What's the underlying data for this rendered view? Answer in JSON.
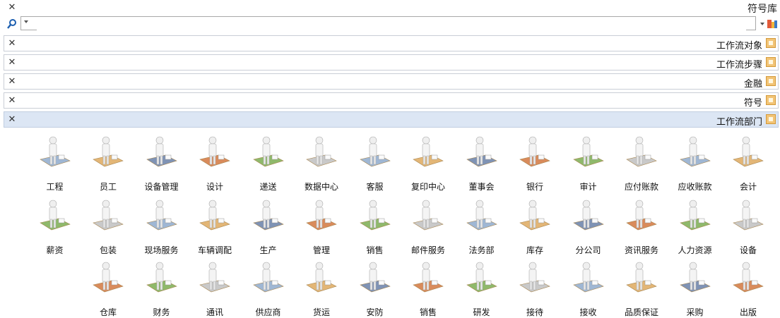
{
  "panel": {
    "title": "符号库"
  },
  "search": {
    "value": "",
    "placeholder": ""
  },
  "categories": [
    {
      "label": "工作流对象",
      "active": false
    },
    {
      "label": "工作流步骤",
      "active": false
    },
    {
      "label": "金融",
      "active": false
    },
    {
      "label": "符号",
      "active": false
    },
    {
      "label": "工作流部门",
      "active": true
    }
  ],
  "shapes": {
    "row1": [
      {
        "label": "会计",
        "icon": "accountant-icon"
      },
      {
        "label": "应收账款",
        "icon": "accounts-receivable-icon"
      },
      {
        "label": "应付账款",
        "icon": "accounts-payable-icon"
      },
      {
        "label": "审计",
        "icon": "audit-icon"
      },
      {
        "label": "银行",
        "icon": "bank-icon"
      },
      {
        "label": "董事会",
        "icon": "board-meeting-icon"
      },
      {
        "label": "复印中心",
        "icon": "copy-center-icon"
      },
      {
        "label": "客服",
        "icon": "customer-service-icon"
      },
      {
        "label": "数据中心",
        "icon": "data-center-icon"
      },
      {
        "label": "递送",
        "icon": "delivery-icon"
      },
      {
        "label": "设计",
        "icon": "design-icon"
      },
      {
        "label": "设备管理",
        "icon": "equipment-management-icon"
      },
      {
        "label": "员工",
        "icon": "employee-icon"
      },
      {
        "label": "工程",
        "icon": "engineering-icon"
      }
    ],
    "row2": [
      {
        "label": "设备",
        "icon": "facilities-icon"
      },
      {
        "label": "人力资源",
        "icon": "human-resources-icon"
      },
      {
        "label": "资讯服务",
        "icon": "information-services-icon"
      },
      {
        "label": "分公司",
        "icon": "branch-office-icon"
      },
      {
        "label": "库存",
        "icon": "inventory-icon"
      },
      {
        "label": "法务部",
        "icon": "legal-department-icon"
      },
      {
        "label": "邮件服务",
        "icon": "mail-service-icon"
      },
      {
        "label": "销售",
        "icon": "sales-icon"
      },
      {
        "label": "管理",
        "icon": "management-icon"
      },
      {
        "label": "生产",
        "icon": "production-icon"
      },
      {
        "label": "车辆调配",
        "icon": "vehicle-dispatch-icon"
      },
      {
        "label": "现场服务",
        "icon": "field-service-icon"
      },
      {
        "label": "包装",
        "icon": "packaging-icon"
      },
      {
        "label": "薪资",
        "icon": "payroll-icon"
      }
    ],
    "row3": [
      {
        "label": "出版",
        "icon": "publishing-icon"
      },
      {
        "label": "采购",
        "icon": "purchasing-icon"
      },
      {
        "label": "品质保证",
        "icon": "quality-assurance-icon"
      },
      {
        "label": "接收",
        "icon": "receiving-icon"
      },
      {
        "label": "接待",
        "icon": "reception-icon"
      },
      {
        "label": "研发",
        "icon": "research-development-icon"
      },
      {
        "label": "销售",
        "icon": "sales-person-icon"
      },
      {
        "label": "安防",
        "icon": "security-icon"
      },
      {
        "label": "货运",
        "icon": "shipping-icon"
      },
      {
        "label": "供应商",
        "icon": "supplier-icon"
      },
      {
        "label": "通讯",
        "icon": "telecommunications-icon"
      },
      {
        "label": "财务",
        "icon": "finance-icon"
      },
      {
        "label": "仓库",
        "icon": "warehouse-icon"
      }
    ]
  },
  "colors": {
    "active_category_bg": "#dce6f4",
    "desk": "#e3b676",
    "figure": "#f2f2f2"
  }
}
